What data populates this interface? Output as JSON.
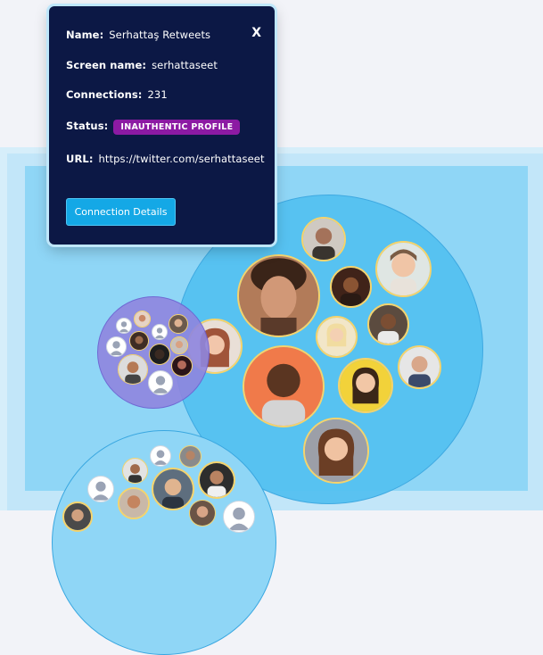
{
  "profile_popup": {
    "name_label": "Name:",
    "name_value": "Serhattaş Retweets",
    "screen_name_label": "Screen name:",
    "screen_name_value": "serhattaseet",
    "connections_label": "Connections:",
    "connections_value": "231",
    "status_label": "Status:",
    "status_badge": "INAUTHENTIC PROFILE",
    "url_label": "URL:",
    "url_value": "https://twitter.com/serhattaseet",
    "close_label": "X",
    "details_button": "Connection Details"
  },
  "colors": {
    "popup_bg": "#0c1845",
    "badge_bg": "#8c1aa3",
    "button_bg": "#14a8e6",
    "cluster_main": "#55c1f1",
    "cluster_purple": "#8f86df"
  },
  "graph": {
    "clusters": [
      "main-cluster",
      "purple-cluster",
      "bottom-cluster"
    ]
  }
}
